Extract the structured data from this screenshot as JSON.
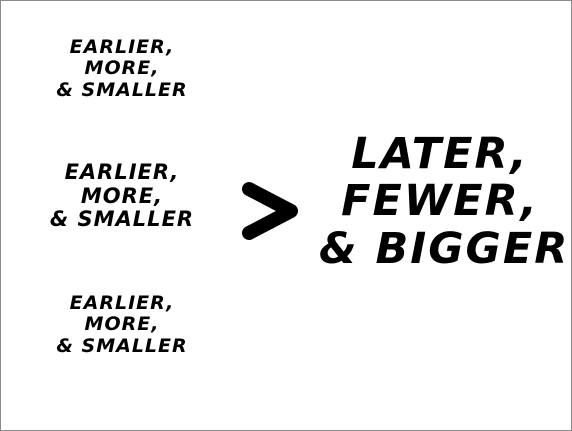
{
  "slide": {
    "left_groups": [
      {
        "lines": [
          "EARLIER,",
          "MORE,",
          "& SMALLER"
        ]
      },
      {
        "lines": [
          "EARLIER,",
          "MORE,",
          "& SMALLER"
        ]
      },
      {
        "lines": [
          "EARLIER,",
          "MORE,",
          "& SMALLER"
        ]
      }
    ],
    "comparison_symbol": "greater-than-icon",
    "right_group": {
      "lines": [
        "LATER,",
        "FEWER,",
        "& BIGGER"
      ]
    },
    "colors": {
      "background": "#ffffff",
      "text": "#000000",
      "border": "#8a8a8a"
    }
  }
}
